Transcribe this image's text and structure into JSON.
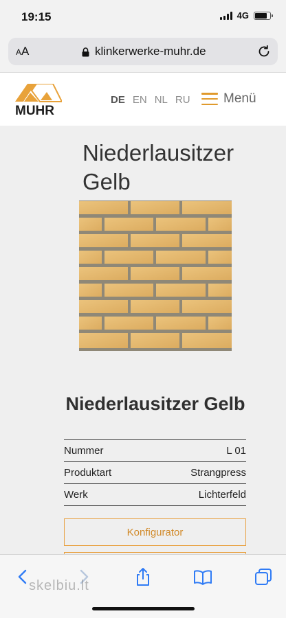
{
  "status": {
    "time": "19:15",
    "network": "4G"
  },
  "browser": {
    "text_size_label": "AA",
    "url": "klinkerwerke-muhr.de"
  },
  "header": {
    "logo_text": "MUHR",
    "languages": [
      "DE",
      "EN",
      "NL",
      "RU"
    ],
    "active_language": "DE",
    "menu_label": "Menü",
    "accent_color": "#e09a2c"
  },
  "product": {
    "page_title": "Niederlausitzer Gelb",
    "title": "Niederlausitzer Gelb",
    "specs": [
      {
        "label": "Nummer",
        "value": "L 01"
      },
      {
        "label": "Produktart",
        "value": "Strangpress"
      },
      {
        "label": "Werk",
        "value": "Lichterfeld"
      }
    ],
    "primary_action": "Konfigurator"
  },
  "toolbar": {
    "icons": [
      "back-icon",
      "forward-icon",
      "share-icon",
      "bookmarks-icon",
      "tabs-icon"
    ]
  },
  "watermark": "skelbiu.lt"
}
